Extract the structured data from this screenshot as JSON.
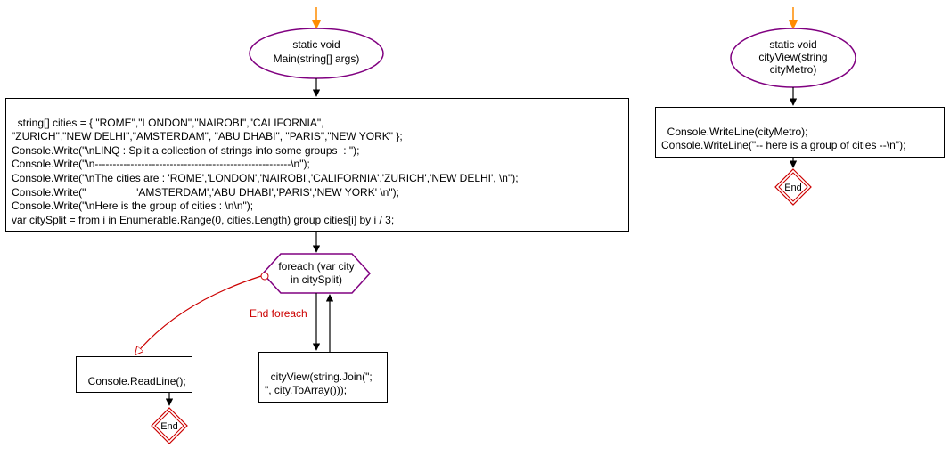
{
  "colors": {
    "purple": "#800080",
    "red": "#cc0000",
    "orange": "#ff8c00",
    "black": "#000000"
  },
  "main": {
    "ellipse": {
      "line1": "static void",
      "line2": "Main(string[] args)"
    },
    "codeBlock": "string[] cities = { \"ROME\",\"LONDON\",\"NAIROBI\",\"CALIFORNIA\",\n\"ZURICH\",\"NEW DELHI\",\"AMSTERDAM\", \"ABU DHABI\", \"PARIS\",\"NEW YORK\" };\nConsole.Write(\"\\nLINQ : Split a collection of strings into some groups  : \");\nConsole.Write(\"\\n-------------------------------------------------------\\n\");\nConsole.Write(\"\\nThe cities are : 'ROME','LONDON','NAIROBI','CALIFORNIA','ZURICH','NEW DELHI', \\n\");\nConsole.Write(\"                 'AMSTERDAM','ABU DHABI','PARIS','NEW YORK' \\n\");\nConsole.Write(\"\\nHere is the group of cities : \\n\\n\");\nvar citySplit = from i in Enumerable.Range(0, cities.Length) group cities[i] by i / 3;",
    "foreach": {
      "line1": "foreach (var city",
      "line2": "in citySplit)"
    },
    "foreachEndLabel": "End foreach",
    "cityViewCall": "cityView(string.Join(\";\n\", city.ToArray()));",
    "readLine": "Console.ReadLine();",
    "end": "End"
  },
  "cityView": {
    "ellipse": {
      "line1": "static void",
      "line2": "cityView(string",
      "line3": "cityMetro)"
    },
    "codeBlock": "Console.WriteLine(cityMetro);\nConsole.WriteLine(\"-- here is a group of cities --\\n\");",
    "end": "End"
  }
}
